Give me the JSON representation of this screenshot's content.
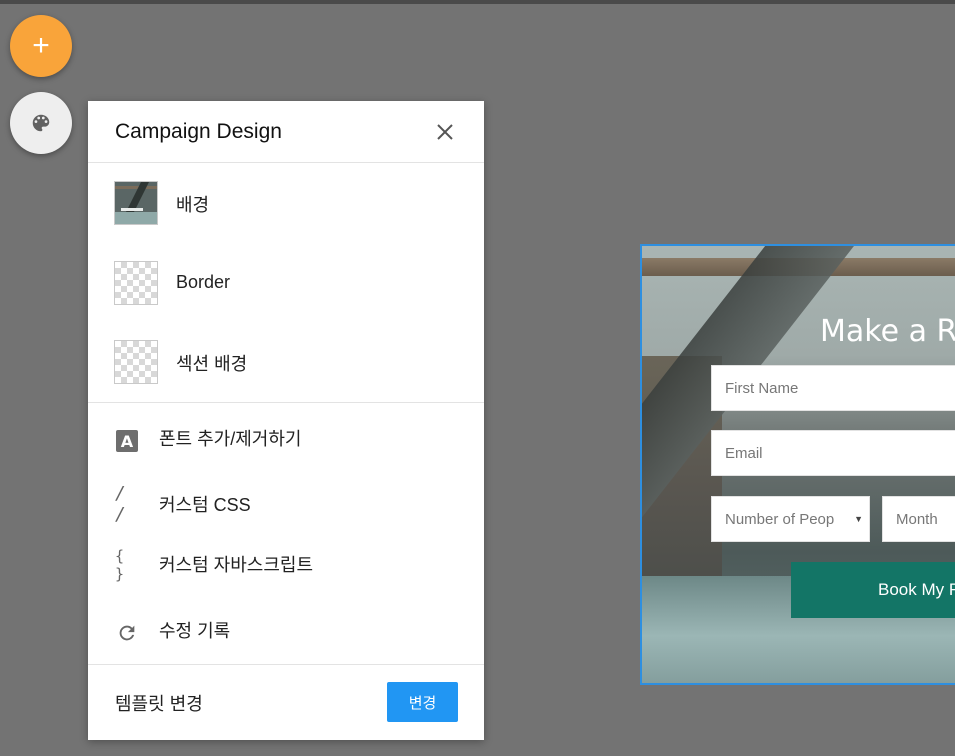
{
  "fab": {
    "add_label": "+",
    "add_icon": "plus-icon",
    "palette_icon": "palette-icon"
  },
  "panel": {
    "title": "Campaign Design",
    "close_icon": "close-icon",
    "design_items": [
      {
        "label": "배경",
        "swatch": "background-image-thumbnail"
      },
      {
        "label": "Border",
        "swatch": "transparent-checker"
      },
      {
        "label": "섹션 배경",
        "swatch": "transparent-checker"
      }
    ],
    "tools": [
      {
        "label": "폰트 추가/제거하기",
        "icon": "font-icon",
        "glyph": "A"
      },
      {
        "label": "커스텀 CSS",
        "icon": "css-slashes-icon",
        "glyph": "/ /"
      },
      {
        "label": "커스텀 자바스크립트",
        "icon": "braces-icon",
        "glyph": "{ }"
      },
      {
        "label": "수정 기록",
        "icon": "refresh-history-icon",
        "glyph": ""
      }
    ],
    "footer": {
      "label": "템플릿 변경",
      "button_label": "변경"
    }
  },
  "preview": {
    "title": "Make a Re",
    "first_name_placeholder": "First Name",
    "email_placeholder": "Email",
    "people_select": "Number of Peop",
    "month_select": "Month",
    "book_button": "Book My R"
  },
  "colors": {
    "accent": "#2196f3",
    "fab_orange": "#f9a43a",
    "book_green": "#137566",
    "overlay": "#737373"
  }
}
